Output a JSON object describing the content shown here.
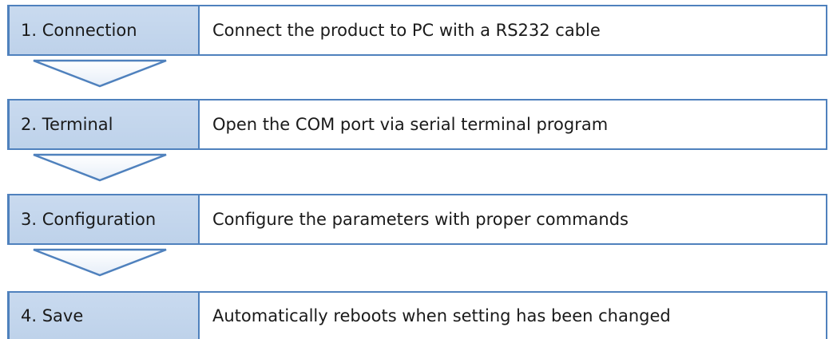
{
  "steps": [
    {
      "label": "1. Connection",
      "description": "Connect the product to PC with a RS232 cable"
    },
    {
      "label": "2. Terminal",
      "description": "Open the COM port via serial terminal program"
    },
    {
      "label": "3. Configuration",
      "description": "Configure the parameters with proper commands"
    },
    {
      "label": "4. Save",
      "description": "Automatically reboots when setting has been changed"
    }
  ],
  "colors": {
    "accent": "#4f81bd",
    "label_fill": "#c6d9f1"
  },
  "icons": {
    "connector": "down-chevron-icon"
  }
}
